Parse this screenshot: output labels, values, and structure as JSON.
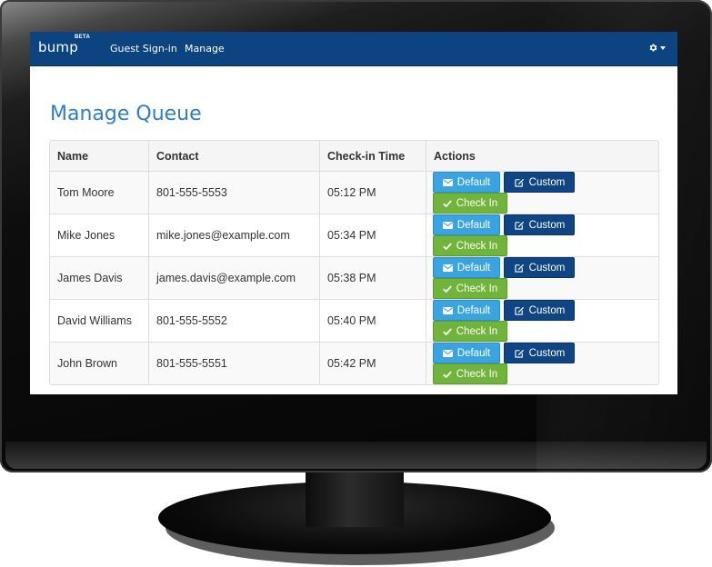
{
  "app": {
    "brand": "bump",
    "badge": "BETA"
  },
  "nav": {
    "links": [
      "Guest Sign-in",
      "Manage"
    ],
    "settings_icon": "gear-icon"
  },
  "page": {
    "title": "Manage Queue"
  },
  "table": {
    "headers": [
      "Name",
      "Contact",
      "Check-in Time",
      "Actions"
    ],
    "rows": [
      {
        "name": "Tom Moore",
        "contact": "801-555-5553",
        "time": "05:12 PM"
      },
      {
        "name": "Mike Jones",
        "contact": "mike.jones@example.com",
        "time": "05:34 PM"
      },
      {
        "name": "James Davis",
        "contact": "james.davis@example.com",
        "time": "05:38 PM"
      },
      {
        "name": "David Williams",
        "contact": "801-555-5552",
        "time": "05:40 PM"
      },
      {
        "name": "John Brown",
        "contact": "801-555-5551",
        "time": "05:42 PM"
      }
    ]
  },
  "actions": {
    "default": {
      "label": "Default",
      "icon": "envelope-icon",
      "color": "#3aa4e3"
    },
    "custom": {
      "label": "Custom",
      "icon": "edit-icon",
      "color": "#0e4582"
    },
    "checkin": {
      "label": "Check In",
      "icon": "checkmark-icon",
      "color": "#70b43b"
    }
  },
  "colors": {
    "navbar": "#0c4482",
    "title": "#2e7fbf"
  }
}
